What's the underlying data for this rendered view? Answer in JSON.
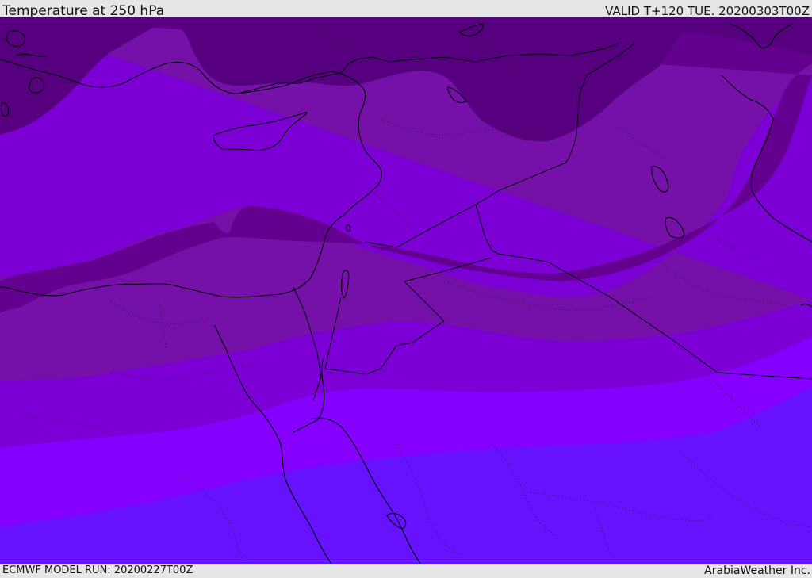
{
  "header": {
    "title": "Temperature at 250 hPa",
    "valid": "VALID T+120 TUE. 20200303T00Z"
  },
  "footer": {
    "model_run": "ECMWF MODEL RUN: 20200227T00Z",
    "credit": "ArabiaWeather Inc."
  },
  "map": {
    "field": "temperature",
    "level": "250 hPa",
    "colors": {
      "band_darkest": "#560080",
      "band_dark": "#64008f",
      "band_mid": "#7511a8",
      "band_violet": "#7c00d6",
      "band_bright": "#8500ff",
      "band_blue": "#6612ff",
      "coastline": "#000000"
    }
  }
}
